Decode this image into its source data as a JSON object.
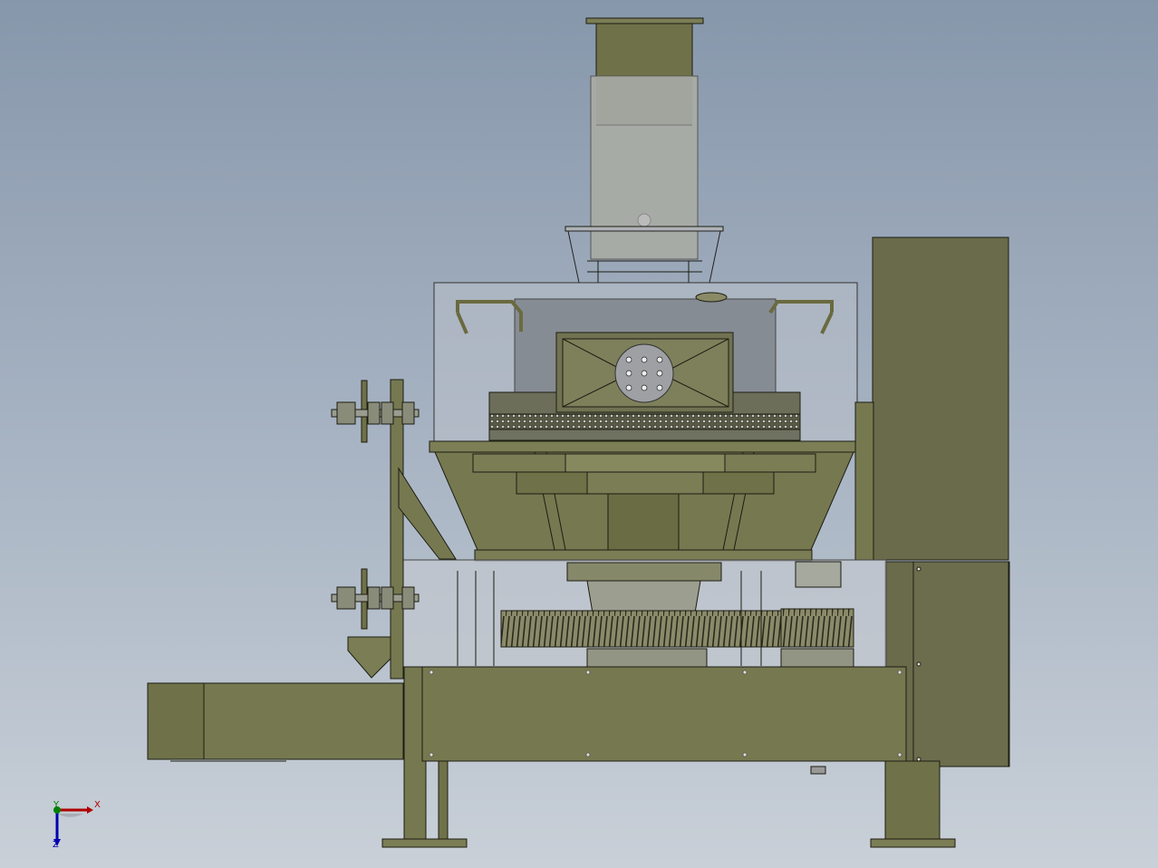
{
  "viewport": {
    "background_top": "#8797ab",
    "background_bottom": "#c9d0d8"
  },
  "model": {
    "body_color": "#767850",
    "body_shadow": "#5f6240",
    "edge_color": "#1c1d12",
    "glass_color": "#b9bfc8",
    "panel_color": "#6a6b4b"
  },
  "triad": {
    "x_label": "X",
    "y_label": "Y",
    "z_label": "Z",
    "x_color": "#b00000",
    "y_color": "#008000",
    "z_color": "#0000b0"
  }
}
